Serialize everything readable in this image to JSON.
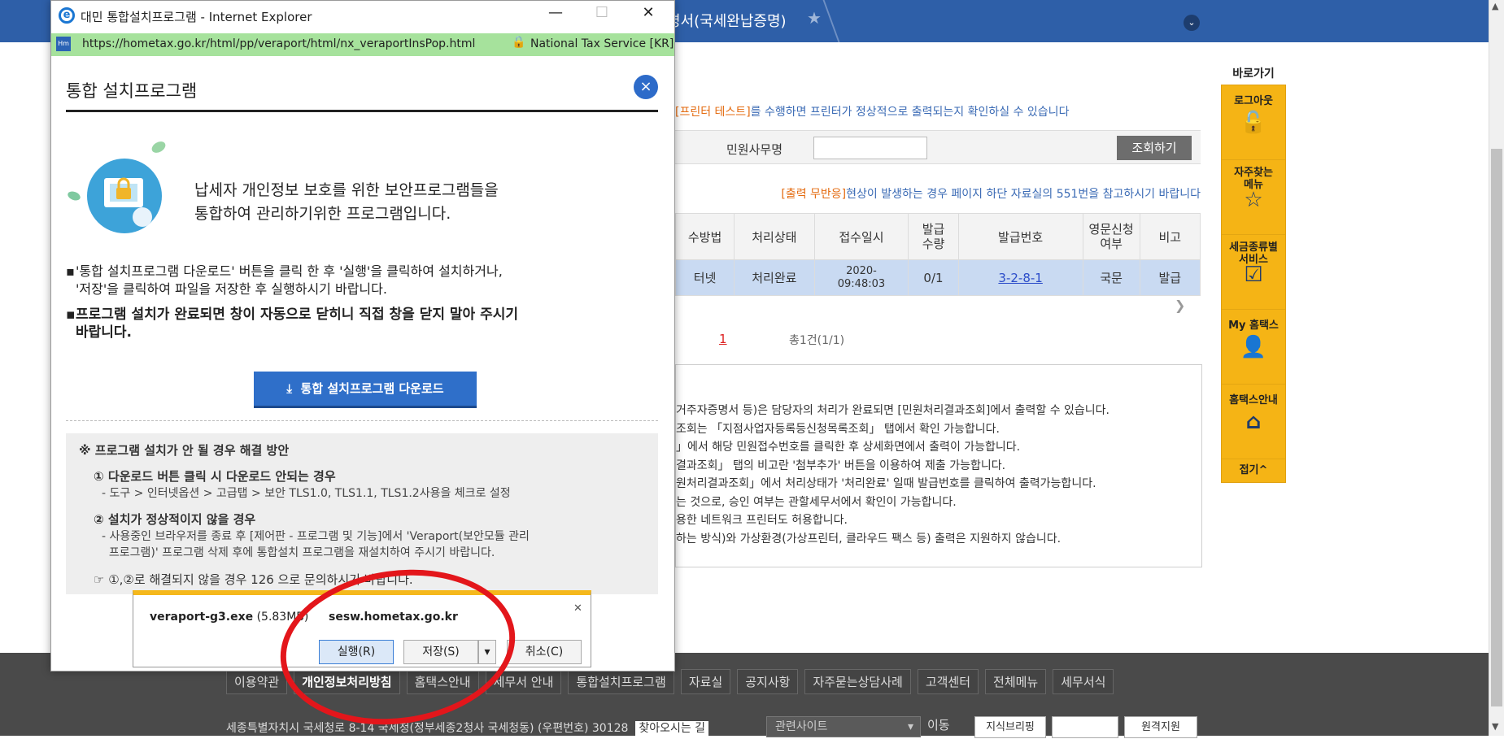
{
  "topbar": {
    "crumb": "명서(국세완납증명)"
  },
  "notes": {
    "printer_prefix": "[프린터 테스트]",
    "printer_rest": "를 수행하면 프린터가 정상적으로 출력되는지 확인하실 수 있습니다",
    "nopress_prefix": "[출력 무반응]",
    "nopress_rest": "현상이 발생하는 경우 페이지 하단 자료실의 551번을 참고하시기 바랍니다"
  },
  "search": {
    "label": "민원사무명",
    "value": "",
    "button": "조회하기"
  },
  "table": {
    "headers": [
      "수방법",
      "처리상태",
      "접수일시",
      "발급\n수량",
      "발급번호",
      "영문신청\n여부",
      "비고"
    ],
    "row": {
      "method": "터넷",
      "status": "처리완료",
      "date1": "2020-",
      "date2": "09:48:03",
      "qty": "0/1",
      "issue_no": "3-2-8-1",
      "lang": "국문",
      "note": "발급"
    }
  },
  "pager": {
    "current": "1",
    "total": "총1건(1/1)"
  },
  "notice_lines": [
    "거주자증명서 등)은 담당자의 처리가 완료되면 [민원처리결과조회]에서 출력할 수 있습니다.",
    "조회는 「지점사업자등록등신청목록조회」 탭에서 확인 가능합니다.",
    "」에서 해당 민원접수번호를 클릭한 후 상세화면에서 출력이 가능합니다.",
    "결과조회」 탭의 비고란 '첨부추가' 버튼을 이용하여 제출 가능합니다.",
    "원처리결과조회」에서 처리상태가 '처리완료' 일때 발급번호를 클릭하여 출력가능합니다.",
    "는 것으로, 승인 여부는 관할세무서에서 확인이 가능합니다.",
    "용한 네트워크 프린터도 허용합니다.",
    "하는 방식)와 가상환경(가상프린터, 클라우드 팩스 등) 출력은 지원하지 않습니다."
  ],
  "quicklinks": {
    "title": "바로가기",
    "items": [
      {
        "label": "로그아웃",
        "icon": "unlock-icon"
      },
      {
        "label": "자주찾는\n메뉴",
        "icon": "star-icon"
      },
      {
        "label": "세금종류별\n서비스",
        "icon": "checkbox-icon"
      },
      {
        "label": "My 홈택스",
        "icon": "user-icon"
      },
      {
        "label": "홈택스안내",
        "icon": "house-icon"
      }
    ],
    "fold": "접기^"
  },
  "footer": {
    "links": [
      "이용약관",
      "개인정보처리방침",
      "홈택스안내",
      "세무서 안내",
      "통합설치프로그램",
      "자료실",
      "공지사항",
      "자주묻는상담사례",
      "고객센터",
      "전체메뉴",
      "세무서식"
    ],
    "address": "세종특별자치시 국세청로 8-14 국세청(정부세종2청사 국세청동) (우편번호) 30128",
    "find_way": "찾아오시는 길",
    "related": "관련사이트",
    "go": "이동",
    "ext": [
      "지식브리핑",
      "",
      "원격지원"
    ]
  },
  "ie": {
    "title": "대민 통합설치프로그램 - Internet Explorer",
    "url": "https://hometax.go.kr/html/pp/veraport/html/nx_veraportInsPop.html",
    "site": "National Tax Service [KR]",
    "heading": "통합 설치프로그램",
    "intro_line1": "납세자 개인정보 보호를 위한 보안프로그램들을",
    "intro_line2": "통합하여 관리하기위한 프로그램입니다.",
    "bullet1_line1": "'통합 설치프로그램 다운로드' 버튼을 클릭 한 후 '실행'을 클릭하여 설치하거나,",
    "bullet1_line2": "'저장'을 클릭하여 파일을 저장한 후 실행하시기 바랍니다.",
    "bullet2_line1": "프로그램 설치가 완료되면 창이 자동으로 닫히니 직접 창을 닫지 말아 주시기",
    "bullet2_line2": "바랍니다.",
    "download_button": "통합 설치프로그램 다운로드",
    "help_title": "※ 프로그램 설치가 안 될 경우 해결 방안",
    "help1_title": "① 다운로드 버튼 클릭 시 다운로드 안되는 경우",
    "help1_desc": "- 도구 > 인터넷옵션 > 고급탭 > 보안 TLS1.0, TLS1.1, TLS1.2사용을 체크로 설정",
    "help2_title": "② 설치가 정상적이지 않을 경우",
    "help2_desc1": "- 사용중인 브라우저를 종료 후 [제어판 - 프로그램 및 기능]에서 'Veraport(보안모듈 관리",
    "help2_desc2": "프로그램)' 프로그램 삭제 후에 통합설치 프로그램을 재설치하여 주시기 바랍니다.",
    "help_footer": "☞ ①,②로 해결되지 않을 경우 126 으로 문의하시기 바랍니다."
  },
  "download_bar": {
    "filename": "veraport-g3.exe",
    "size": "(5.83MB)",
    "source": "sesw.hometax.go.kr",
    "run": "실행(R)",
    "save": "저장(S)",
    "cancel": "취소(C)"
  }
}
